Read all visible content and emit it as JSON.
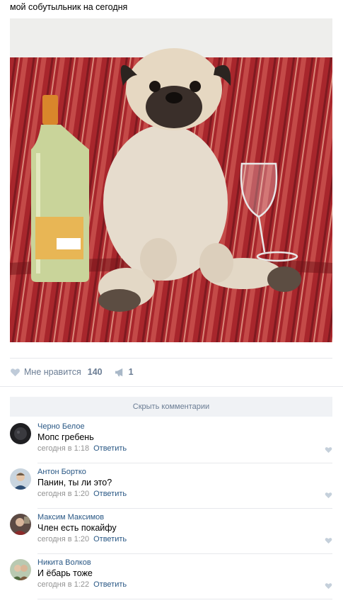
{
  "post": {
    "text": "мой собутыльник на сегодня"
  },
  "actions": {
    "like_label": "Мне нравится",
    "like_count": "140",
    "share_count": "1"
  },
  "comments_bar": {
    "label": "Скрыть комментарии"
  },
  "comments": [
    {
      "author": "Черно Белое",
      "text": "Мопс гребень",
      "time": "сегодня в 1:18",
      "reply": "Ответить"
    },
    {
      "author": "Антон Бортко",
      "text": "Панин, ты ли это?",
      "time": "сегодня в 1:20",
      "reply": "Ответить"
    },
    {
      "author": "Максим Максимов",
      "text": "Член есть покайфу",
      "time": "сегодня в 1:20",
      "reply": "Ответить"
    },
    {
      "author": "Никита Волков",
      "text": "И ёбарь тоже",
      "time": "сегодня в 1:22",
      "reply": "Ответить"
    }
  ],
  "colors": {
    "link": "#2a5885",
    "action": "#6b7d94",
    "meta": "#939393",
    "bar_bg": "#f0f2f5",
    "sofa_red": "#a8262c",
    "pug_fawn": "#e6dccd"
  },
  "icons": [
    "heart-icon",
    "megaphone-icon",
    "avatar"
  ]
}
